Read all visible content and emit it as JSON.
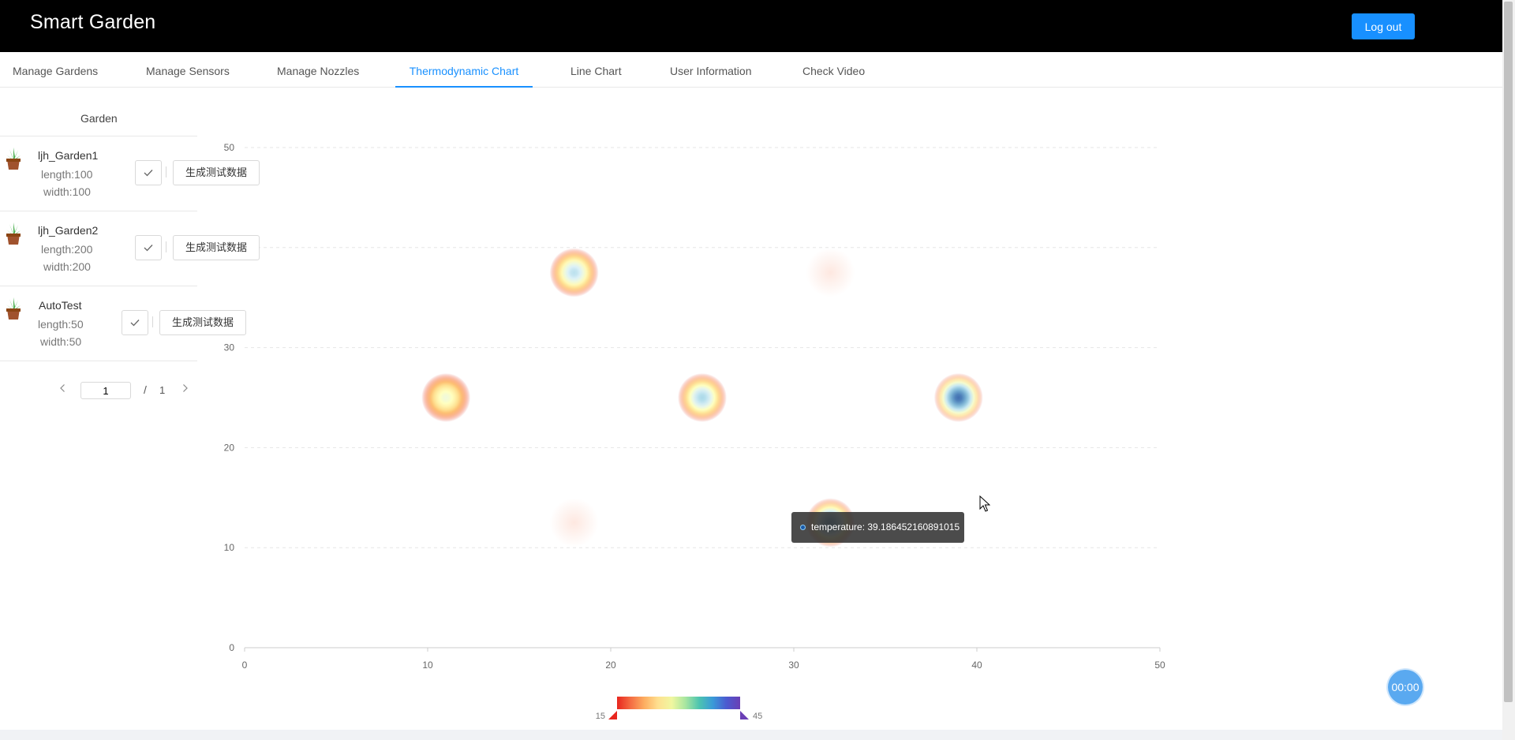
{
  "app": {
    "title": "Smart Garden",
    "logout_label": "Log out"
  },
  "tabs": [
    {
      "label": "Manage Gardens"
    },
    {
      "label": "Manage Sensors"
    },
    {
      "label": "Manage Nozzles"
    },
    {
      "label": "Thermodynamic Chart",
      "active": true
    },
    {
      "label": "Line Chart"
    },
    {
      "label": "User Information"
    },
    {
      "label": "Check Video"
    }
  ],
  "gardens": {
    "column_header": "Garden",
    "generate_label": "生成测试数据",
    "items": [
      {
        "name": "ljh_Garden1",
        "length": "length:100",
        "width": "width:100"
      },
      {
        "name": "ljh_Garden2",
        "length": "length:200",
        "width": "width:200"
      },
      {
        "name": "AutoTest",
        "length": "length:50",
        "width": "width:50"
      }
    ]
  },
  "pagination": {
    "current": "1",
    "separator": "/",
    "total": "1"
  },
  "chart_data": {
    "type": "heatmap",
    "title": "",
    "xlabel": "",
    "ylabel": "",
    "xlim": [
      0,
      50
    ],
    "ylim": [
      0,
      50
    ],
    "x_ticks": [
      "0",
      "10",
      "20",
      "30",
      "40",
      "50"
    ],
    "y_ticks": [
      "0",
      "10",
      "20",
      "30",
      "40",
      "50"
    ],
    "grid": true,
    "points": [
      {
        "x": 18,
        "y": 37.5,
        "value": 34
      },
      {
        "x": 32,
        "y": 37.5,
        "value": 16
      },
      {
        "x": 11,
        "y": 25,
        "value": 30
      },
      {
        "x": 25,
        "y": 25,
        "value": 35
      },
      {
        "x": 39,
        "y": 25,
        "value": 42
      },
      {
        "x": 18,
        "y": 12.5,
        "value": 16
      },
      {
        "x": 32,
        "y": 12.5,
        "value": 39.186452160891015
      }
    ],
    "visual_map": {
      "min": 15,
      "max": 45,
      "min_label": "15",
      "max_label": "45"
    },
    "colors": [
      "#d73027",
      "#f46d43",
      "#fdae61",
      "#fee090",
      "#ffffbf",
      "#e0f3f8",
      "#abd9e9",
      "#74add1",
      "#4575b4",
      "#313695"
    ],
    "tooltip": {
      "text": "temperature: 39.186452160891015"
    }
  },
  "video_timer": "00:00"
}
